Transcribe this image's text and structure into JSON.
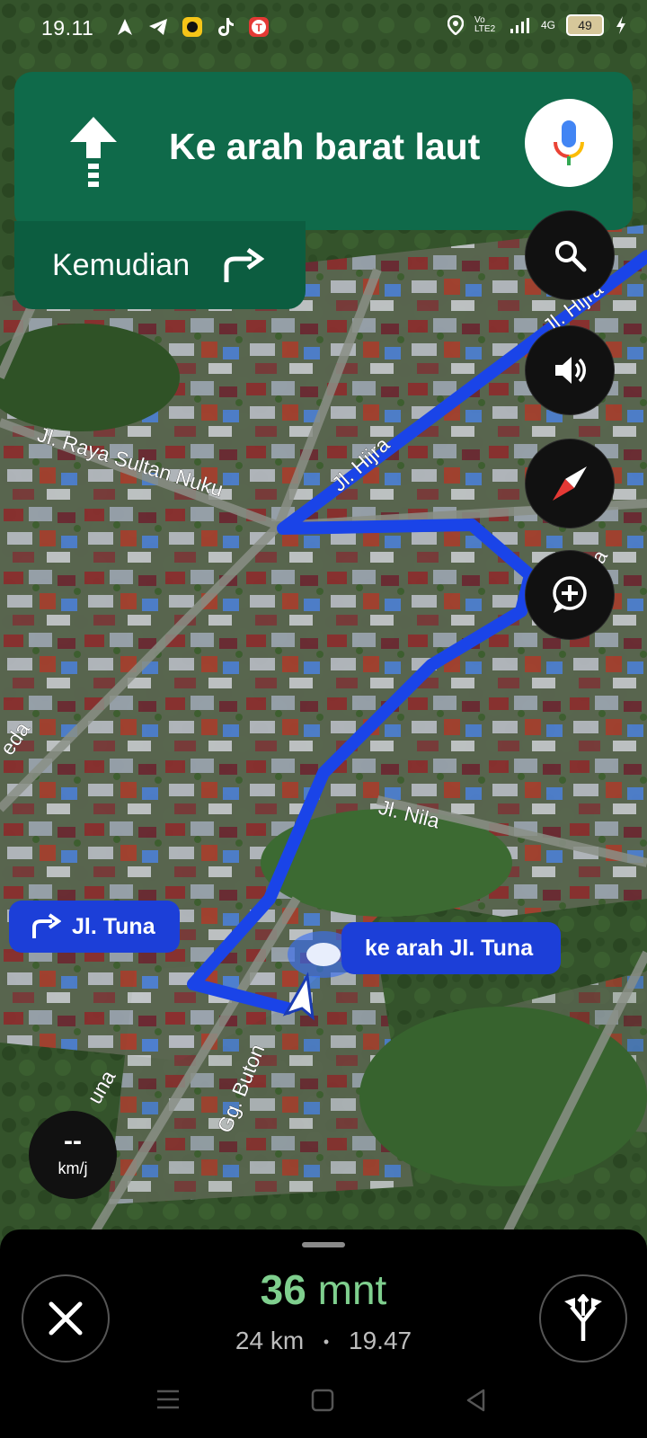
{
  "status_bar": {
    "time": "19.11",
    "battery": "49",
    "network_4g": "4G",
    "volte": "Vo LTE2",
    "icons": [
      "navigation-arrow-icon",
      "telegram-icon",
      "app-icon",
      "tiktok-icon",
      "t-app-icon",
      "location-icon",
      "signal-icon",
      "battery-icon",
      "charging-icon"
    ]
  },
  "navigation": {
    "direction": "Ke arah barat laut",
    "then_label": "Kemudian",
    "then_icon": "turn-right-icon",
    "direction_icon": "straight-arrow-icon"
  },
  "map": {
    "street_labels": [
      "Jl. Raya Sultan Nuku",
      "Jl. Hijra",
      "Jl. Hijra",
      "Jl. Nila",
      "Gg. Buton",
      "eda",
      "una",
      "na"
    ],
    "turn_label": "Jl. Tuna",
    "heading_label": "ke arah Jl. Tuna",
    "route_color": "#1a44e8"
  },
  "controls": {
    "search": "search-icon",
    "sound": "volume-icon",
    "compass": "compass-icon",
    "report": "add-report-icon"
  },
  "speed": {
    "value": "--",
    "unit": "km/j"
  },
  "trip": {
    "duration_number": "36",
    "duration_unit": "mnt",
    "distance": "24 km",
    "separator": "•",
    "arrival": "19.47",
    "eta_color": "#7fcf8e"
  }
}
